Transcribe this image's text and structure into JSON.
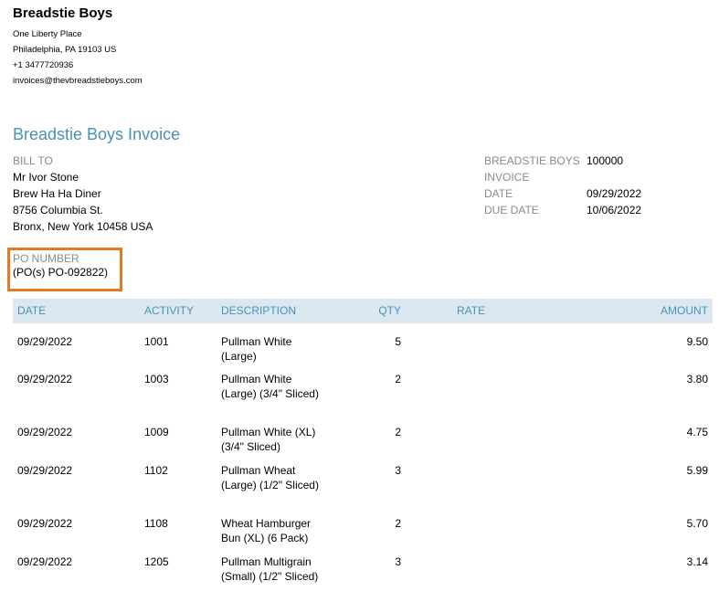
{
  "company": {
    "name": "Breadstie Boys",
    "address_line1": "One Liberty Place",
    "address_line2": "Philadelphia, PA  19103 US",
    "phone": "+1 3477720936",
    "email": "invoices@thevbreadstieboys.com"
  },
  "invoice_title": "Breadstie Boys Invoice",
  "bill_to": {
    "label": "BILL TO",
    "name": "Mr Ivor Stone",
    "business": "Brew Ha Ha Diner",
    "street": "8756 Columbia St.",
    "city": "Bronx, New York  10458 USA"
  },
  "meta": {
    "invoice_label_line1": "BREADSTIE BOYS",
    "invoice_label_line2": "INVOICE",
    "invoice_number": "100000",
    "date_label": "DATE",
    "date": "09/29/2022",
    "due_label": "DUE DATE",
    "due_date": "10/06/2022"
  },
  "po": {
    "label": "PO NUMBER",
    "value": "(PO(s) PO-092822)"
  },
  "table": {
    "headers": {
      "date": "DATE",
      "activity": "ACTIVITY",
      "description": "DESCRIPTION",
      "qty": "QTY",
      "rate": "RATE",
      "amount": "AMOUNT"
    },
    "rows": [
      {
        "date": "09/29/2022",
        "activity": "1001",
        "description": "Pullman White (Large)",
        "qty": "5",
        "rate": "",
        "amount": "9.50"
      },
      {
        "date": "09/29/2022",
        "activity": "1003",
        "description": "Pullman White (Large) (3/4\" Sliced)",
        "qty": "2",
        "rate": "",
        "amount": "3.80"
      },
      {
        "date": "09/29/2022",
        "activity": "1009",
        "description": "Pullman White (XL) (3/4\" Sliced)",
        "qty": "2",
        "rate": "",
        "amount": "4.75"
      },
      {
        "date": "09/29/2022",
        "activity": "1102",
        "description": "Pullman Wheat (Large) (1/2\" Sliced)",
        "qty": "3",
        "rate": "",
        "amount": "5.99"
      },
      {
        "date": "09/29/2022",
        "activity": "1108",
        "description": "Wheat Hamburger Bun (XL) (6 Pack)",
        "qty": "2",
        "rate": "",
        "amount": "5.70"
      },
      {
        "date": "09/29/2022",
        "activity": "1205",
        "description": "Pullman Multigrain (Small) (1/2\" Sliced)",
        "qty": "3",
        "rate": "",
        "amount": "3.14"
      }
    ]
  },
  "colors": {
    "accent": "#4a90b8",
    "header_bg": "#dce8f1",
    "highlight_border": "#e07b28",
    "label_grey": "#8a8a8a"
  }
}
